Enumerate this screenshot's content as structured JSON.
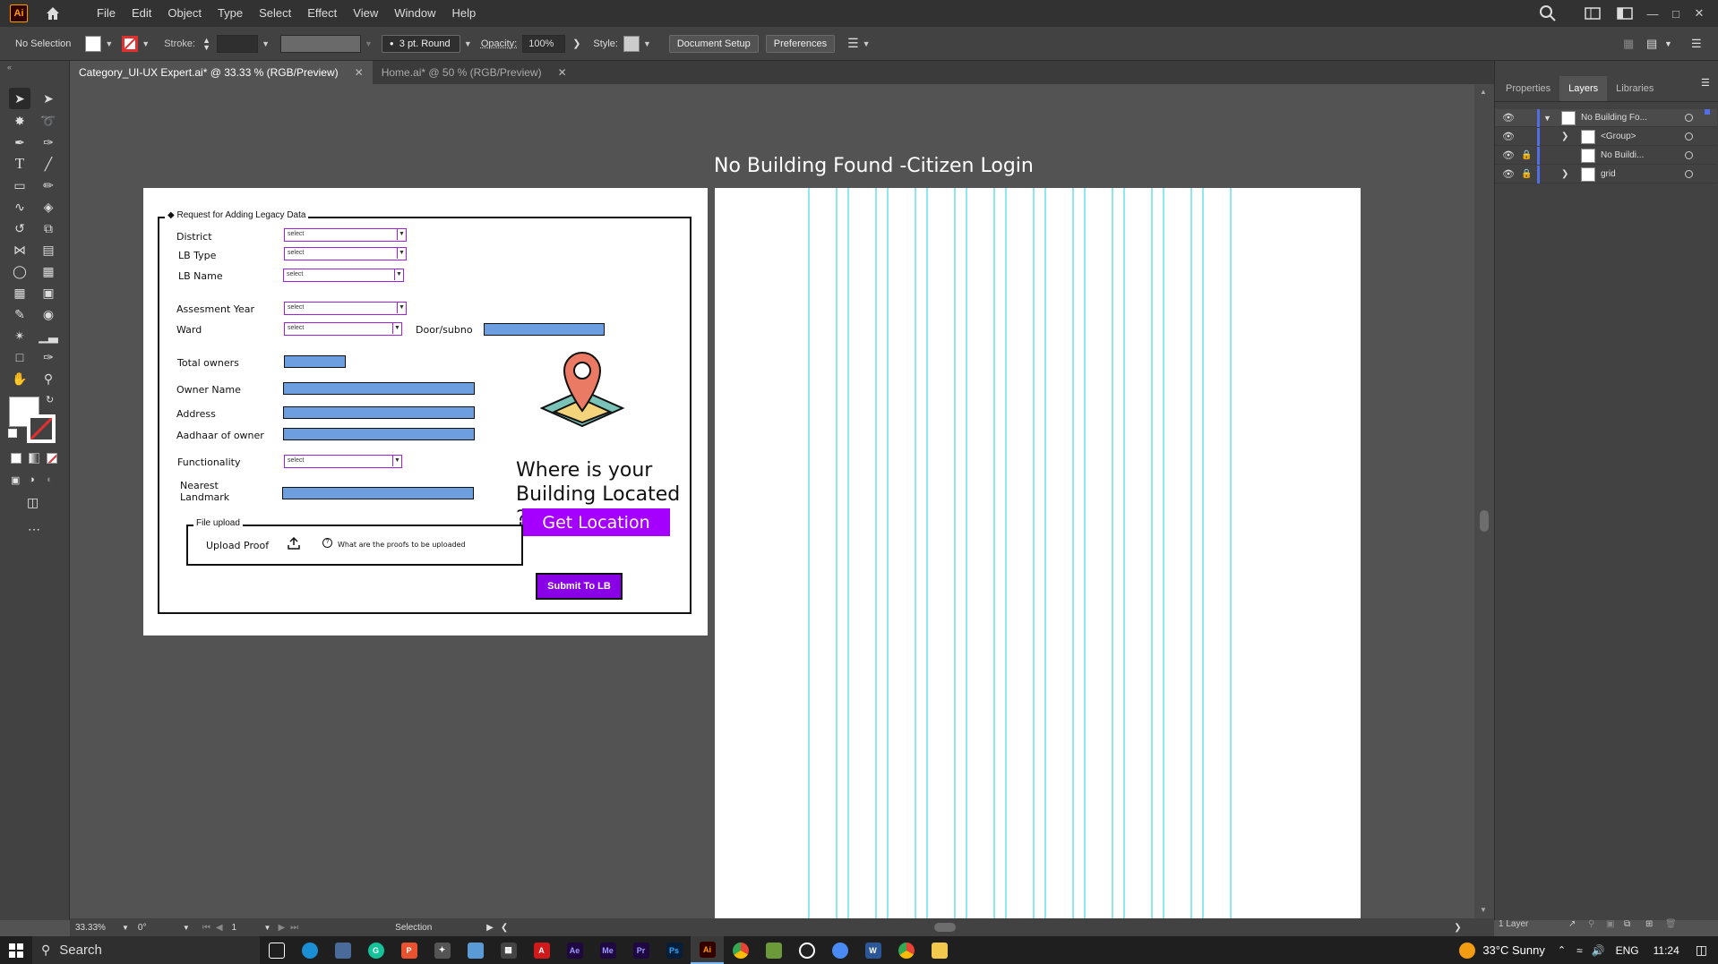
{
  "app": {
    "logo": "Ai",
    "menu": [
      "File",
      "Edit",
      "Object",
      "Type",
      "Select",
      "Effect",
      "View",
      "Window",
      "Help"
    ]
  },
  "control_bar": {
    "selection": "No Selection",
    "stroke_label": "Stroke:",
    "brush": "3 pt. Round",
    "opacity_label": "Opacity:",
    "opacity_value": "100%",
    "style_label": "Style:",
    "document_setup": "Document Setup",
    "preferences": "Preferences"
  },
  "tabs": [
    {
      "label": "Category_UI-UX Expert.ai* @ 33.33 % (RGB/Preview)",
      "active": true
    },
    {
      "label": "Home.ai* @ 50 % (RGB/Preview)",
      "active": false
    }
  ],
  "panel": {
    "tabs": [
      "Properties",
      "Layers",
      "Libraries"
    ],
    "active_tab": "Layers",
    "layers": [
      {
        "name": "No Building Fo...",
        "locked": false,
        "expanded": true
      },
      {
        "name": "<Group>",
        "locked": false,
        "expanded": false
      },
      {
        "name": "No Buildi...",
        "locked": true,
        "expanded": false
      },
      {
        "name": "grid",
        "locked": true,
        "expanded": false
      }
    ],
    "footer": "1 Layer"
  },
  "status": {
    "zoom": "33.33%",
    "rotation": "0°",
    "artboard": "1",
    "tool": "Selection"
  },
  "canvas": {
    "artboard_title": "No Building Found -Citizen Login",
    "form": {
      "legend": "Request for Adding Legacy Data",
      "fields": {
        "district": "District",
        "lb_type": "LB  Type",
        "lb_name": "LB Name",
        "assessment_year": "Assesment Year",
        "ward": "Ward",
        "door": "Door/subno",
        "total_owners": "Total owners",
        "owner_name": "Owner Name",
        "address": "Address",
        "aadhaar": "Aadhaar of owner",
        "functionality": "Functionality",
        "nearest_landmark": "Nearest Landmark"
      },
      "select_placeholder": "select",
      "file_upload_legend": "File upload",
      "upload_proof": "Upload Proof",
      "proof_hint": "What are the proofs to be uploaded",
      "where_line1": "Where is your",
      "where_line2": "Building Located ?",
      "get_location": "Get Location",
      "submit": "Submit To LB"
    }
  },
  "taskbar": {
    "search": "Search",
    "weather": "33°C  Sunny",
    "lang": "ENG",
    "time": "11:24"
  },
  "colors": {
    "accent_purple": "#a500ff",
    "submit_purple": "#8a00e6",
    "input_blue": "#6d9fe0",
    "grid_cyan": "#8ee8ee"
  }
}
